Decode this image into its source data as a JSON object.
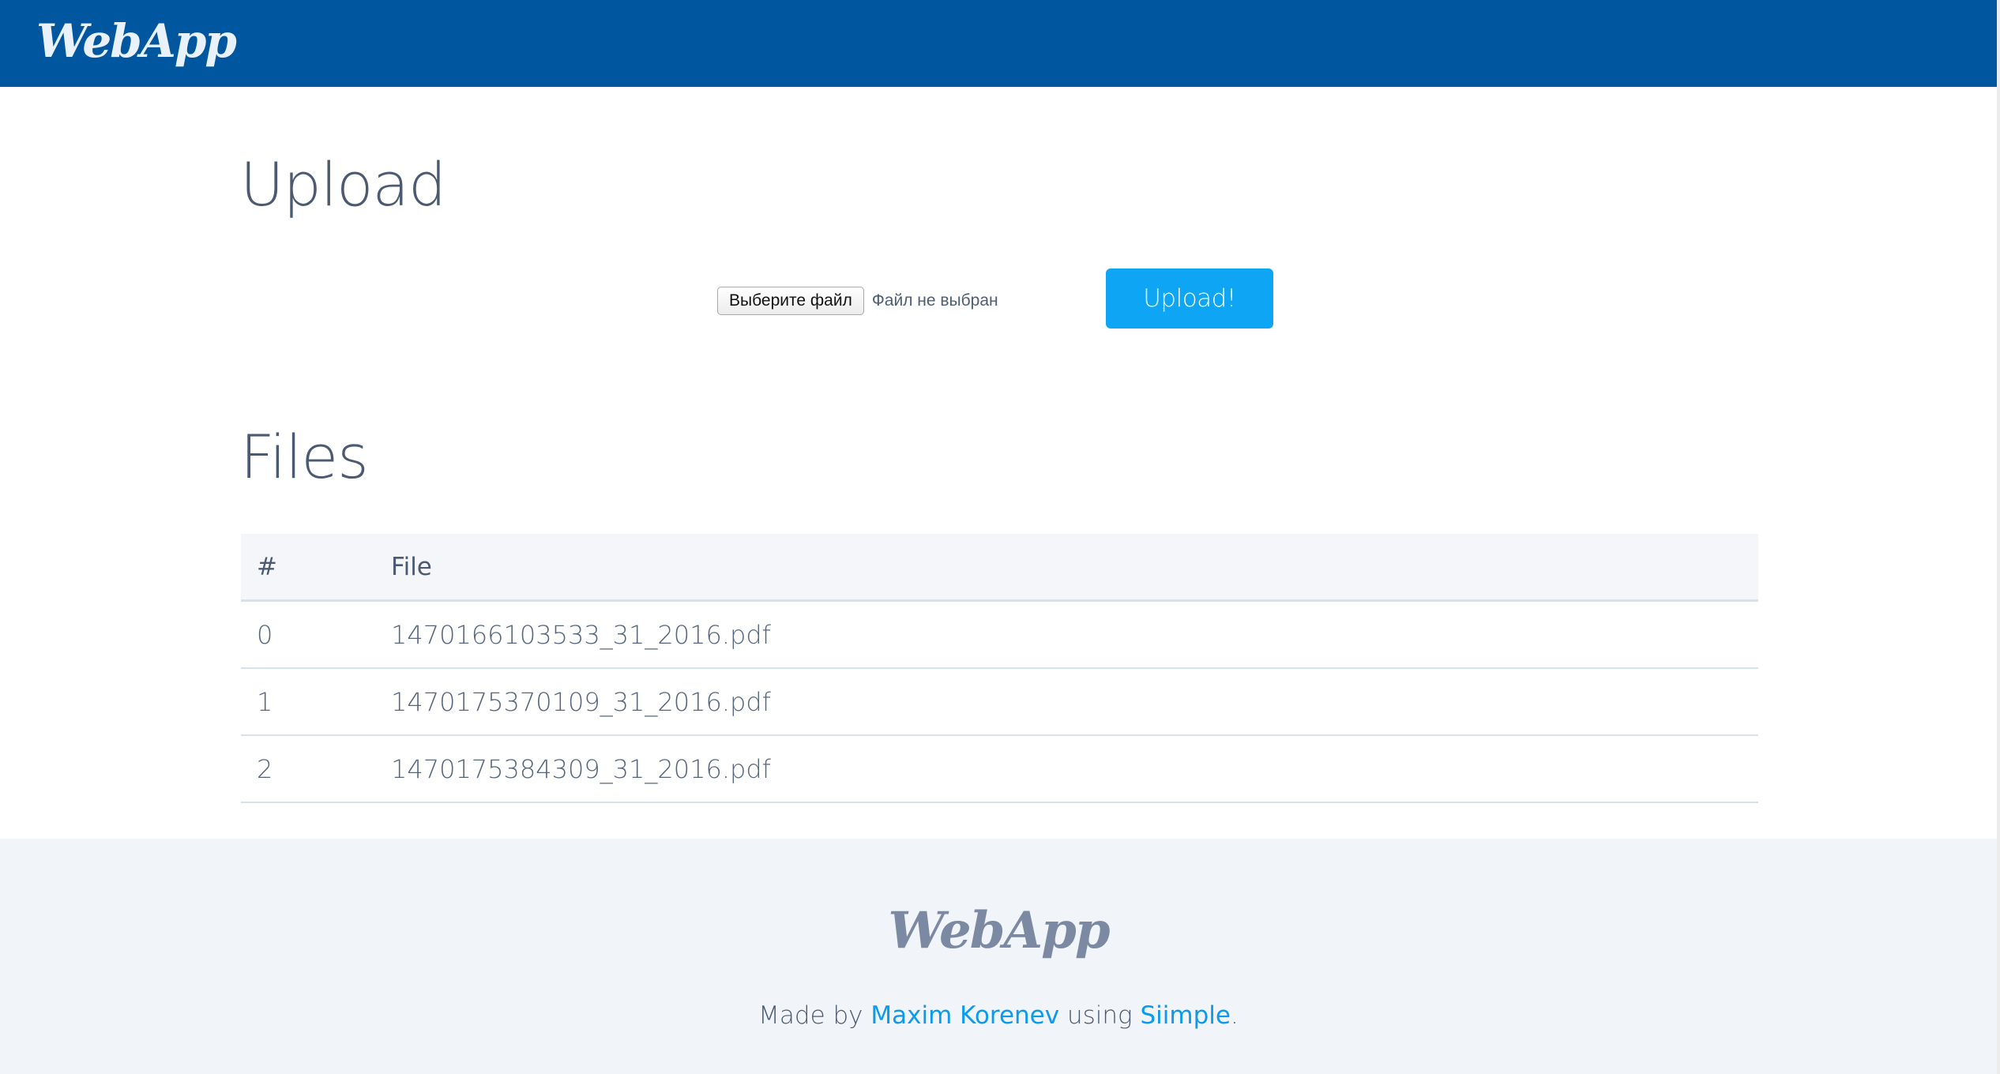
{
  "navbar": {
    "brand": "WebApp",
    "color": "#01579f"
  },
  "upload": {
    "title": "Upload",
    "choose_file_label": "Выберите файл",
    "file_status": "Файл не выбран",
    "submit_label": "Upload!",
    "submit_color": "#0ea5f5"
  },
  "files": {
    "title": "Files",
    "columns": [
      "#",
      "File"
    ],
    "rows": [
      {
        "num": "0",
        "file": "1470166103533_31_2016.pdf"
      },
      {
        "num": "1",
        "file": "1470175370109_31_2016.pdf"
      },
      {
        "num": "2",
        "file": "1470175384309_31_2016.pdf"
      }
    ]
  },
  "footer": {
    "logo": "WebApp",
    "made_by_prefix": "Made by",
    "author_link": "Maxim Korenev",
    "using_text": "using",
    "framework_link": "Siimple",
    "suffix": ".",
    "link_color": "#0b9aee"
  }
}
